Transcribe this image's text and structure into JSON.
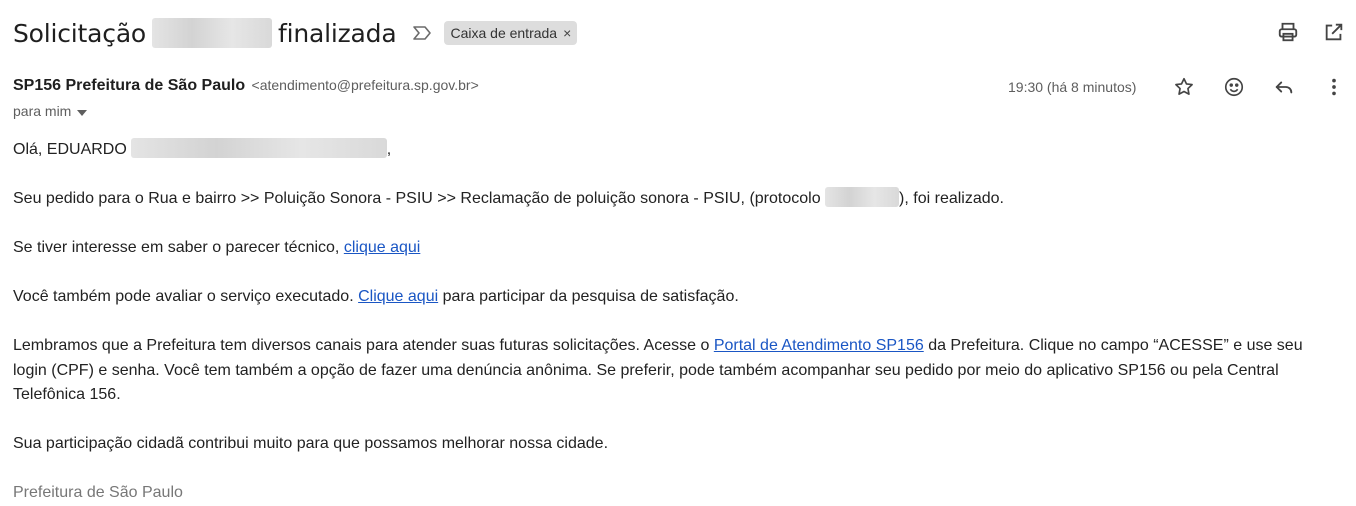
{
  "subject": {
    "before": "Solicitação",
    "after": "finalizada",
    "label": "Caixa de entrada"
  },
  "sender": {
    "name": "SP156 Prefeitura de São Paulo",
    "email": "<atendimento@prefeitura.sp.gov.br>",
    "to": "para mim"
  },
  "time": "19:30 (há 8 minutos)",
  "toolbar_icons": [
    "print-icon",
    "open-new-window-icon",
    "star-icon",
    "emoji-icon",
    "reply-icon",
    "more-vert-icon"
  ],
  "body": {
    "greeting_prefix": "Olá, EDUARDO",
    "greeting_suffix": ",",
    "p1_before": "Seu pedido para o Rua e bairro >> Poluição Sonora - PSIU >> Reclamação de poluição sonora - PSIU, (protocolo",
    "p1_after": "), foi realizado.",
    "p2_text": "Se tiver interesse em saber o parecer técnico,",
    "p2_link": "clique aqui",
    "p3_before": "Você também pode avaliar o serviço executado.",
    "p3_link": "Clique aqui",
    "p3_after": "para participar da pesquisa de satisfação.",
    "p4_before": "Lembramos que a Prefeitura tem diversos canais para atender suas futuras solicitações. Acesse o",
    "p4_link": "Portal de Atendimento SP156",
    "p4_after": "da Prefeitura. Clique no campo “ACESSE” e use seu login (CPF) e senha. Você tem também a opção de fazer uma denúncia anônima. Se preferir, pode também acompanhar seu pedido por meio do aplicativo SP156 ou pela Central Telefônica 156.",
    "p5": "Sua participação cidadã contribui muito para que possamos melhorar nossa cidade.",
    "signature": "Prefeitura de São Paulo"
  }
}
